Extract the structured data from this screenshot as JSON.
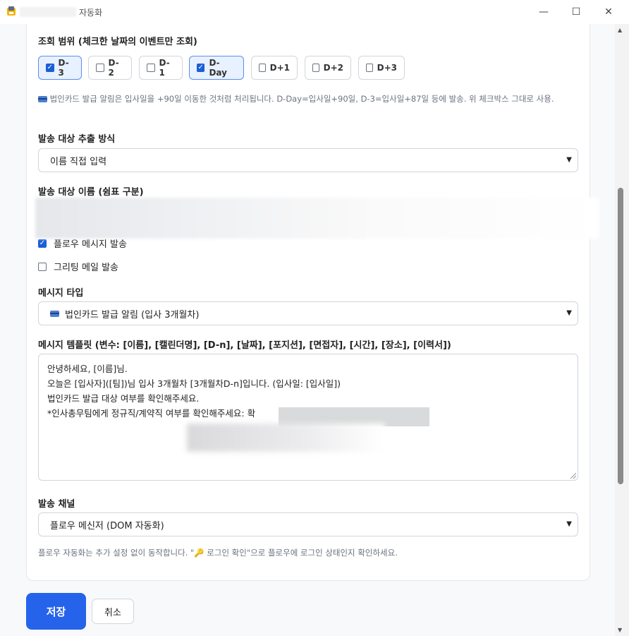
{
  "window": {
    "title": "자동화",
    "minimize": "—",
    "maximize": "☐",
    "close": "✕"
  },
  "range": {
    "label": "조회 범위 (체크한 날짜의 이벤트만 조회)",
    "days": [
      {
        "label": "D-3",
        "checked": true
      },
      {
        "label": "D-2",
        "checked": false
      },
      {
        "label": "D-1",
        "checked": false
      },
      {
        "label": "D-Day",
        "checked": true
      },
      {
        "label": "D+1",
        "checked": false
      },
      {
        "label": "D+2",
        "checked": false
      },
      {
        "label": "D+3",
        "checked": false
      }
    ],
    "hint": "법인카드 발급 알림은 입사일을 +90일 이동한 것처럼 처리됩니다. D-Day=입사일+90일, D-3=입사일+87일 등에 발송. 위 체크박스 그대로 사용."
  },
  "extract": {
    "label": "발송 대상 추출 방식",
    "value": "이름 직접 입력"
  },
  "names": {
    "label": "발송 대상 이름 (쉼표 구분)"
  },
  "options": {
    "flow_message": {
      "label": "플로우 메시지 발송",
      "checked": true
    },
    "greeting_mail": {
      "label": "그리팅 메일 발송",
      "checked": false
    }
  },
  "msg_type": {
    "label": "메시지 타입",
    "value": "법인카드 발급 알림 (입사 3개월차)"
  },
  "template": {
    "label": "메시지 템플릿 (변수: [이름], [캘린더명], [D-n], [날짜], [포지션], [면접자], [시간], [장소], [이력서])",
    "lines": [
      "안녕하세요, [이름]님.",
      "오늘은 [입사자]([팀])님 입사 3개월차 [3개월차D-n]입니다. (입사일: [입사일])",
      "법인카드 발급 대상 여부를 확인해주세요.",
      "*인사총무팀에게 정규직/계약직 여부를 확인해주세요: 확"
    ]
  },
  "channel": {
    "label": "발송 채널",
    "value": "플로우 메신저 (DOM 자동화)",
    "hint": "플로우 자동화는 추가 설정 없이 동작합니다. \"🔑 로그인 확인\"으로 플로우에 로그인 상태인지 확인하세요."
  },
  "actions": {
    "save": "저장",
    "cancel": "취소"
  },
  "colors": {
    "primary": "#2563eb",
    "checked_bg": "#e8f1ff"
  }
}
